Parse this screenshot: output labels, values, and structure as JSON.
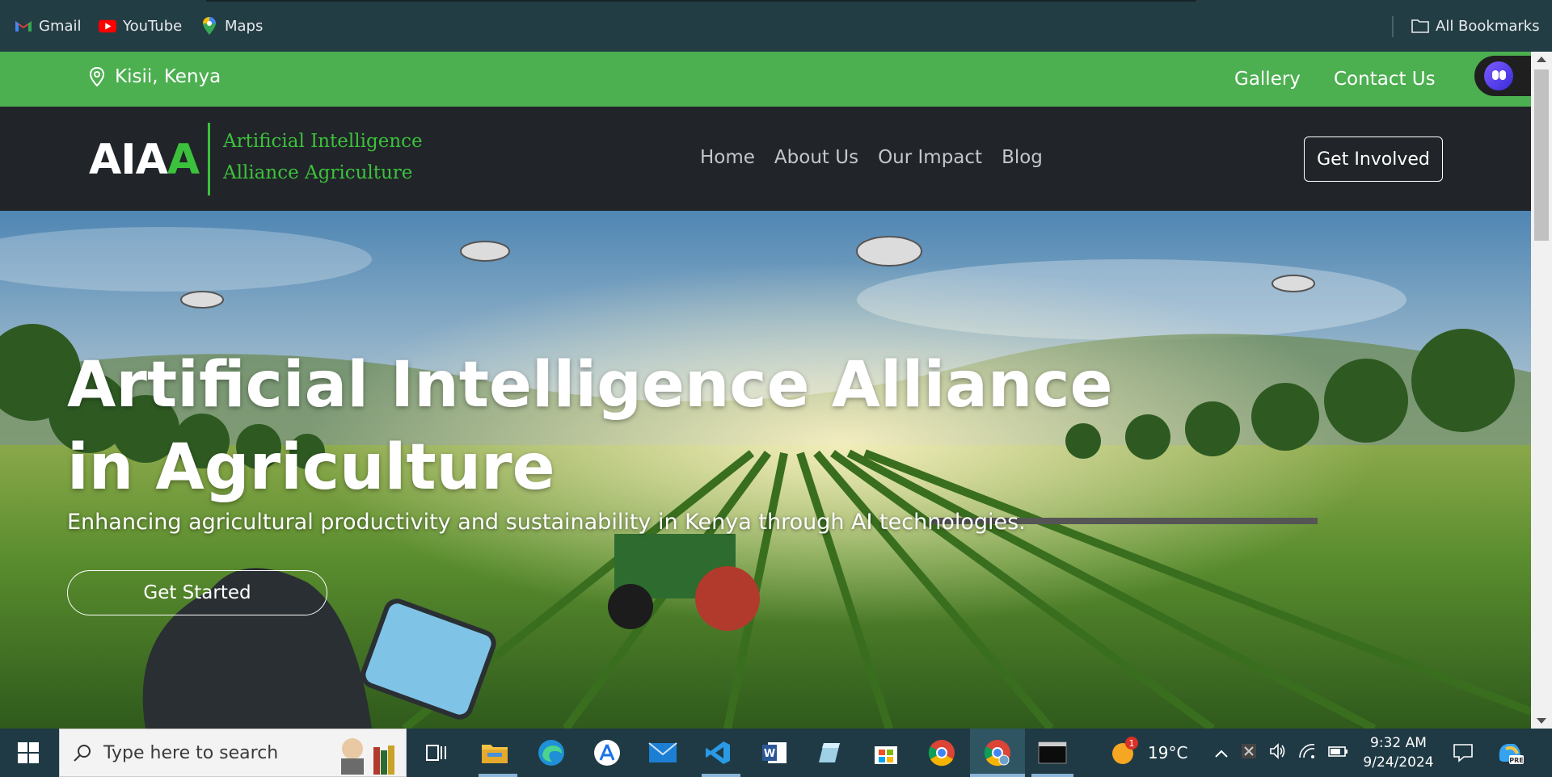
{
  "bookmarks": {
    "items": [
      {
        "label": "Gmail",
        "icon": "gmail-icon"
      },
      {
        "label": "YouTube",
        "icon": "youtube-icon"
      },
      {
        "label": "Maps",
        "icon": "maps-icon"
      }
    ],
    "all_bookmarks": "All Bookmarks"
  },
  "topbar": {
    "location": "Kisii, Kenya",
    "links": [
      "Gallery",
      "Contact Us"
    ]
  },
  "brand": {
    "logo_main": "AIA",
    "logo_accent": "A",
    "tagline_line1": "Artificial Intelligence",
    "tagline_line2": "Alliance Agriculture",
    "accent_color": "#3cc13c"
  },
  "nav": {
    "items": [
      "Home",
      "About Us",
      "Our Impact",
      "Blog"
    ],
    "cta": "Get Involved"
  },
  "hero": {
    "title": "Artificial Intelligence Alliance in Agriculture",
    "subtitle": "Enhancing agricultural productivity and sustainability in Kenya through AI technologies.",
    "button": "Get Started"
  },
  "taskbar": {
    "search_placeholder": "Type here to search",
    "weather_temp": "19°C",
    "weather_badge": "1",
    "time": "9:32 AM",
    "date": "9/24/2024"
  }
}
